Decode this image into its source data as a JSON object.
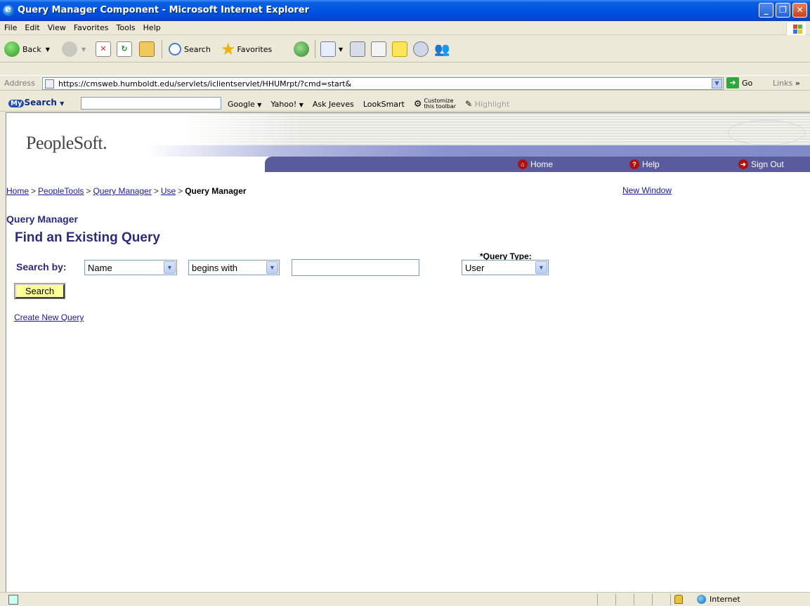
{
  "window": {
    "title": "Query Manager Component - Microsoft Internet Explorer",
    "controls": [
      "_",
      "❐",
      "✕"
    ]
  },
  "menu": [
    "File",
    "Edit",
    "View",
    "Favorites",
    "Tools",
    "Help"
  ],
  "toolbar": {
    "back_label": "Back",
    "search_label": "Search",
    "favorites_label": "Favorites"
  },
  "address": {
    "label": "Address",
    "url": "https://cmsweb.humboldt.edu/servlets/iclientservlet/HHUMrpt/?cmd=start&",
    "go_label": "Go",
    "links_label": "Links"
  },
  "searchbar": {
    "brand": "Search",
    "brand_prefix": "My",
    "items": [
      "Google",
      "Yahoo!",
      "Ask Jeeves",
      "LookSmart"
    ],
    "customize_line1": "Customize",
    "customize_line2": "this toolbar",
    "highlight": "Highlight"
  },
  "page": {
    "logo": "PeopleSoft.",
    "nav": {
      "home": "Home",
      "help": "Help",
      "signout": "Sign Out"
    },
    "breadcrumb": {
      "home": "Home",
      "peopletools": "PeopleTools",
      "query_manager": "Query Manager",
      "use": "Use",
      "current": "Query Manager",
      "sep": ">"
    },
    "new_window": "New Window",
    "component_title": "Query Manager",
    "page_title": "Find an Existing Query",
    "search_by_label": "Search by:",
    "search_by_value": "Name",
    "operator_value": "begins with",
    "search_text": "",
    "query_type_label": "*Query Type:",
    "query_type_value": "User",
    "search_button": "Search",
    "create_link": "Create New Query"
  },
  "status": {
    "zone": "Internet"
  },
  "colors": {
    "titlebar": "#0054e3",
    "ps_nav": "#5a5b9c",
    "ps_heading": "#2b2b7c",
    "link": "#1a1a9a",
    "search_button_bg": "#ffff99"
  }
}
